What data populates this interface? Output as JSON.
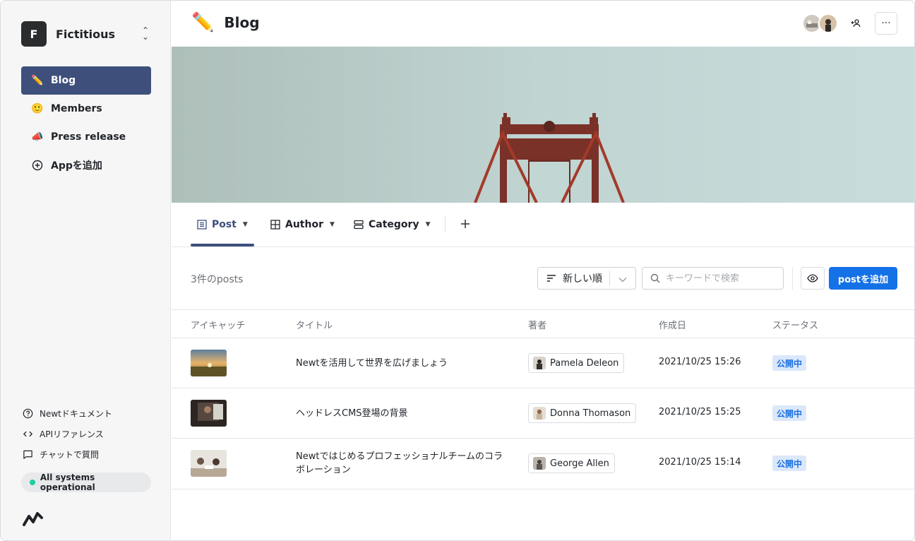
{
  "workspace": {
    "initial": "F",
    "name": "Fictitious"
  },
  "sidebar": {
    "items": [
      {
        "emoji": "✏️",
        "label": "Blog",
        "active": true
      },
      {
        "emoji": "🙂",
        "label": "Members",
        "active": false
      },
      {
        "emoji": "📣",
        "label": "Press release",
        "active": false
      },
      {
        "emoji": "⊕",
        "label": "Appを追加",
        "active": false
      }
    ],
    "links": [
      {
        "icon": "help-circle-icon",
        "label": "Newtドキュメント"
      },
      {
        "icon": "code-icon",
        "label": "APIリファレンス"
      },
      {
        "icon": "chat-icon",
        "label": "チャットで質問"
      }
    ],
    "status": {
      "label": "All systems operational",
      "color": "#1ecfa0"
    }
  },
  "header": {
    "emoji": "✏️",
    "title": "Blog"
  },
  "tabs": [
    {
      "label": "Post",
      "icon": "table-list-icon",
      "active": true
    },
    {
      "label": "Author",
      "icon": "grid-icon",
      "active": false
    },
    {
      "label": "Category",
      "icon": "rows-icon",
      "active": false
    }
  ],
  "toolbar": {
    "count": "3件のposts",
    "sort_label": "新しい順",
    "search_placeholder": "キーワードで検索",
    "add_label": "postを追加",
    "accent": "#1471e6"
  },
  "table": {
    "headers": [
      "アイキャッチ",
      "タイトル",
      "著者",
      "作成日",
      "ステータス"
    ],
    "rows": [
      {
        "title": "Newtを活用して世界を広げましょう",
        "author": "Pamela Deleon",
        "date": "2021/10/25 15:26",
        "status": "公開中"
      },
      {
        "title": "ヘッドレスCMS登場の背景",
        "author": "Donna Thomason",
        "date": "2021/10/25 15:25",
        "status": "公開中"
      },
      {
        "title": "Newtではじめるプロフェッショナルチームのコラボレーション",
        "author": "George Allen",
        "date": "2021/10/25 15:14",
        "status": "公開中"
      }
    ]
  },
  "colors": {
    "nav_active": "#3e4f7c",
    "status_badge_bg": "#dbe8fb",
    "status_badge_text": "#1a6fe0"
  }
}
